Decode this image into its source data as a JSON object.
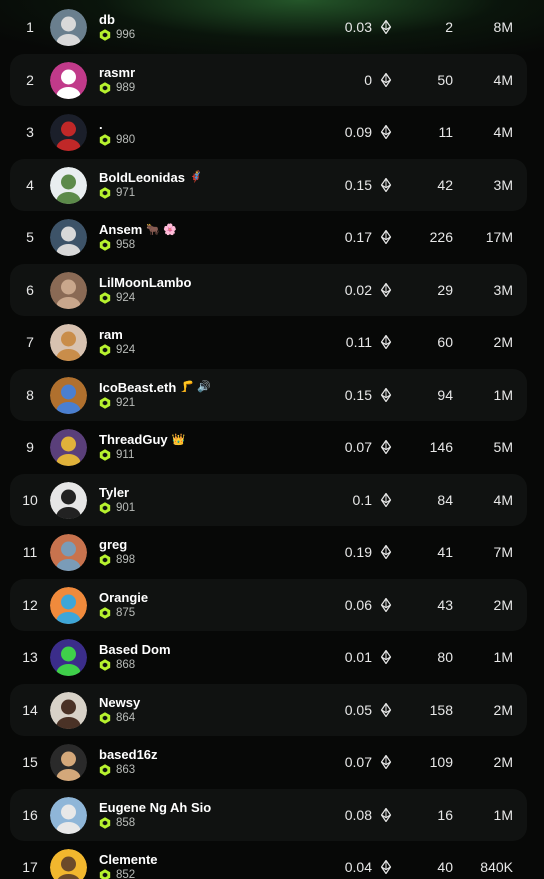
{
  "leaderboard": {
    "rows": [
      {
        "rank": "1",
        "name": "db",
        "badge": "",
        "score": "996",
        "volume": "0.03",
        "trades": "2",
        "followers": "8M",
        "avatar_color": "#6a7f8e",
        "avatar_accent": "#d9d9d9"
      },
      {
        "rank": "2",
        "name": "rasmr",
        "badge": "",
        "score": "989",
        "volume": "0",
        "trades": "50",
        "followers": "4M",
        "avatar_color": "#c13a8a",
        "avatar_accent": "#ffffff"
      },
      {
        "rank": "3",
        "name": ".",
        "badge": "",
        "score": "980",
        "volume": "0.09",
        "trades": "11",
        "followers": "4M",
        "avatar_color": "#1b1f2a",
        "avatar_accent": "#c02828"
      },
      {
        "rank": "4",
        "name": "BoldLeonidas",
        "badge": "🦸",
        "score": "971",
        "volume": "0.15",
        "trades": "42",
        "followers": "3M",
        "avatar_color": "#e9eef0",
        "avatar_accent": "#5c8a4a"
      },
      {
        "rank": "5",
        "name": "Ansem",
        "badge": "🐂 🌸",
        "score": "958",
        "volume": "0.17",
        "trades": "226",
        "followers": "17M",
        "avatar_color": "#3d5368",
        "avatar_accent": "#d8d8d8"
      },
      {
        "rank": "6",
        "name": "LilMoonLambo",
        "badge": "",
        "score": "924",
        "volume": "0.02",
        "trades": "29",
        "followers": "3M",
        "avatar_color": "#8a6a55",
        "avatar_accent": "#c9a78c"
      },
      {
        "rank": "7",
        "name": "ram",
        "badge": "",
        "score": "924",
        "volume": "0.11",
        "trades": "60",
        "followers": "2M",
        "avatar_color": "#d8c2b0",
        "avatar_accent": "#c98d4a"
      },
      {
        "rank": "8",
        "name": "IcoBeast.eth",
        "badge": "🦵 🔊",
        "score": "921",
        "volume": "0.15",
        "trades": "94",
        "followers": "1M",
        "avatar_color": "#b0702e",
        "avatar_accent": "#4a7fd0"
      },
      {
        "rank": "9",
        "name": "ThreadGuy",
        "badge": "👑",
        "score": "911",
        "volume": "0.07",
        "trades": "146",
        "followers": "5M",
        "avatar_color": "#5a3f7a",
        "avatar_accent": "#e0b23a"
      },
      {
        "rank": "10",
        "name": "Tyler",
        "badge": "",
        "score": "901",
        "volume": "0.1",
        "trades": "84",
        "followers": "4M",
        "avatar_color": "#e6e6e6",
        "avatar_accent": "#222222"
      },
      {
        "rank": "11",
        "name": "greg",
        "badge": "",
        "score": "898",
        "volume": "0.19",
        "trades": "41",
        "followers": "7M",
        "avatar_color": "#c8734e",
        "avatar_accent": "#7a9cb8"
      },
      {
        "rank": "12",
        "name": "Orangie",
        "badge": "",
        "score": "875",
        "volume": "0.06",
        "trades": "43",
        "followers": "2M",
        "avatar_color": "#f08a3c",
        "avatar_accent": "#3ea6d8"
      },
      {
        "rank": "13",
        "name": "Based Dom",
        "badge": "",
        "score": "868",
        "volume": "0.01",
        "trades": "80",
        "followers": "1M",
        "avatar_color": "#3b2d8a",
        "avatar_accent": "#3fd04a"
      },
      {
        "rank": "14",
        "name": "Newsy",
        "badge": "",
        "score": "864",
        "volume": "0.05",
        "trades": "158",
        "followers": "2M",
        "avatar_color": "#d8d2c8",
        "avatar_accent": "#4a3226"
      },
      {
        "rank": "15",
        "name": "based16z",
        "badge": "",
        "score": "863",
        "volume": "0.07",
        "trades": "109",
        "followers": "2M",
        "avatar_color": "#2a2a2a",
        "avatar_accent": "#d4a87a"
      },
      {
        "rank": "16",
        "name": "Eugene Ng Ah Sio",
        "badge": "",
        "score": "858",
        "volume": "0.08",
        "trades": "16",
        "followers": "1M",
        "avatar_color": "#8fb6d8",
        "avatar_accent": "#e8e8e8"
      },
      {
        "rank": "17",
        "name": "Clemente",
        "badge": "",
        "score": "852",
        "volume": "0.04",
        "trades": "40",
        "followers": "840K",
        "avatar_color": "#f2b72e",
        "avatar_accent": "#6b4a2a"
      }
    ]
  },
  "colors": {
    "score_hex": "#b7f22e",
    "row_alt_bg": "#101211",
    "header_glow": "#3c9646"
  },
  "icons": {
    "score": "hexagon-icon",
    "currency": "ethereum-icon"
  }
}
